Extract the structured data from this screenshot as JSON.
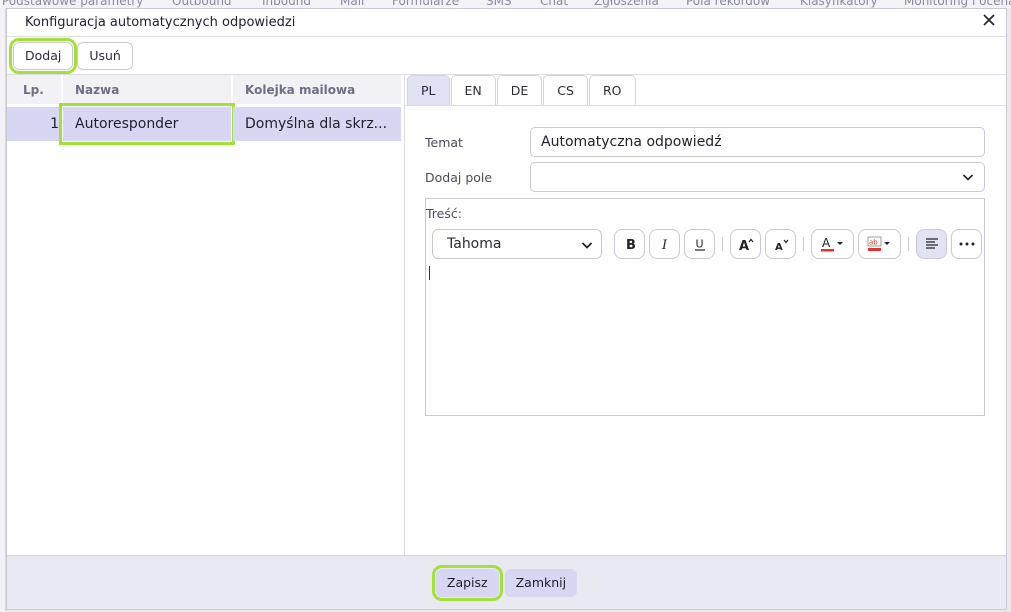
{
  "background_tabs": [
    "Podstawowe parametry",
    "Outbound",
    "Inbound",
    "Mail",
    "Formularze",
    "SMS",
    "Chat",
    "Zgłoszenia",
    "Pola rekordów",
    "Klasyfikatory",
    "Monitoring i ocena"
  ],
  "dialog": {
    "title": "Konfiguracja automatycznych odpowiedzi",
    "close_icon": "close-icon"
  },
  "toolbar": {
    "add_label": "Dodaj",
    "remove_label": "Usuń"
  },
  "table": {
    "columns": [
      "Lp.",
      "Nazwa",
      "Kolejka mailowa"
    ],
    "rows": [
      {
        "lp": "1",
        "nazwa": "Autoresponder",
        "kolejka": "Domyślna dla skrz..."
      }
    ]
  },
  "language_tabs": [
    "PL",
    "EN",
    "DE",
    "CS",
    "RO"
  ],
  "active_tab": "PL",
  "form": {
    "subject_label": "Temat",
    "subject_value": "Automatyczna odpowiedź",
    "add_field_label": "Dodaj pole",
    "add_field_value": "",
    "body_label": "Treść:"
  },
  "editor": {
    "font": "Tahoma",
    "tools": [
      "bold-icon",
      "italic-icon",
      "underline-icon",
      "font-size-increase-icon",
      "font-size-decrease-icon",
      "text-color-icon",
      "highlight-color-icon",
      "align-left-icon",
      "more-icon"
    ]
  },
  "footer": {
    "save_label": "Zapisz",
    "close_label": "Zamknij"
  },
  "colors": {
    "accent": "#d7d7f3",
    "highlight_outline": "#a4e03a",
    "text_color_bar": "#e0342f"
  }
}
